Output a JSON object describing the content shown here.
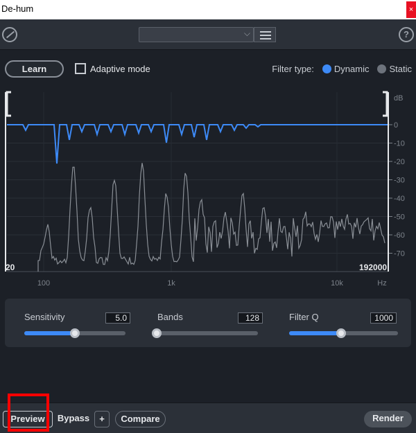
{
  "window": {
    "title": "De-hum",
    "close_glyph": "×"
  },
  "topbar": {
    "module_icon": "dehum-icon",
    "preset_value": "",
    "preset_chevron": "⌵",
    "help_glyph": "?"
  },
  "controls": {
    "learn_label": "Learn",
    "adaptive_label": "Adaptive mode",
    "adaptive_checked": false,
    "filter_type_label": "Filter type:",
    "filter_type_options": [
      "Dynamic",
      "Static"
    ],
    "filter_type_selected": "Dynamic"
  },
  "spectrum": {
    "db_label": "dB",
    "db_ticks": [
      "0",
      "-10",
      "-20",
      "-30",
      "-40",
      "-50",
      "-60",
      "-70"
    ],
    "freq_ticks": [
      "100",
      "1k",
      "10k",
      "Hz"
    ],
    "range_low": "20",
    "range_high": "192000",
    "colors": {
      "filter_curve": "#3d8af7",
      "spectrum": "#8a8f96"
    }
  },
  "parameters": [
    {
      "label": "Sensitivity",
      "value": "5.0",
      "level": 0.5
    },
    {
      "label": "Bands",
      "value": "128",
      "level": 0.0
    },
    {
      "label": "Filter Q",
      "value": "1000",
      "level": 0.48
    }
  ],
  "bottombar": {
    "preview_label": "Preview",
    "bypass_label": "Bypass",
    "plus_label": "+",
    "compare_label": "Compare",
    "render_label": "Render"
  },
  "colors": {
    "accent": "#3d8af7",
    "highlight": "#ff0000"
  }
}
